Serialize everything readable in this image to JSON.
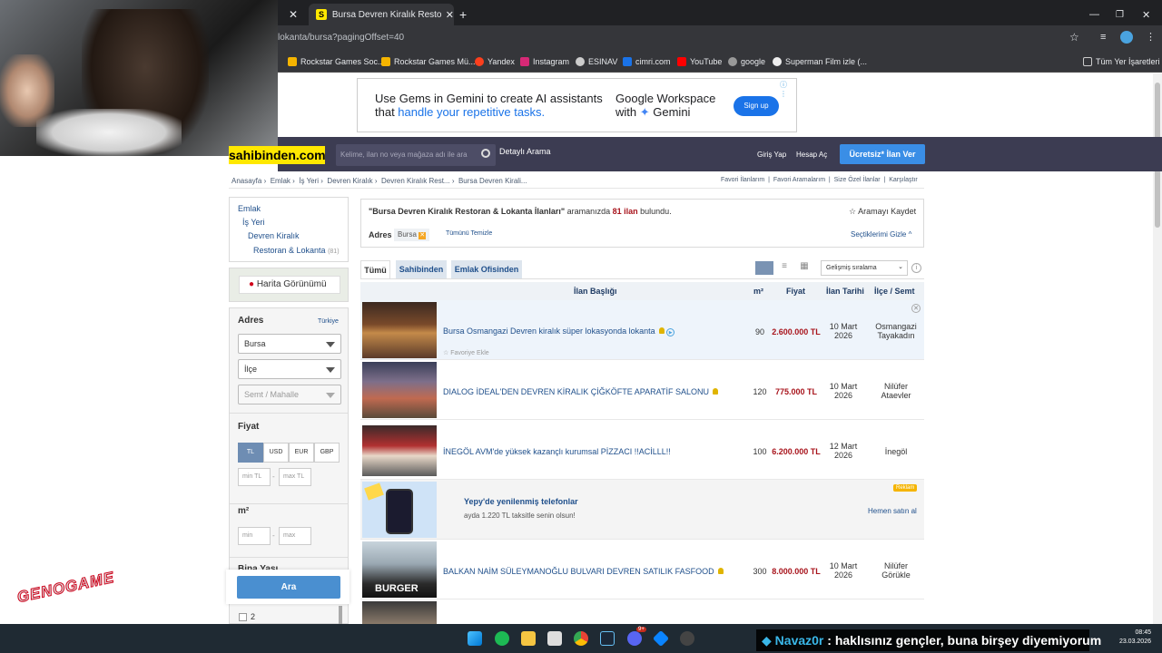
{
  "browser": {
    "active_tab_title": "Bursa Devren Kiralık Restoran &",
    "url": "lokanta/bursa?pagingOffset=40",
    "bookmarks": [
      "Rockstar Games Soc...",
      "Rockstar Games Mü...",
      "Yandex",
      "Instagram",
      "ESINAV",
      "cimri.com",
      "YouTube",
      "google",
      "Superman Film izle (...",
      "Tüm Yer İşaretleri"
    ]
  },
  "ad": {
    "line1": "Use Gems in Gemini to create AI assistants",
    "line2a": "that ",
    "line2b": "handle your repetitive tasks.",
    "brand1": "Google Workspace",
    "brand2a": "with ",
    "brand2b": "Gemini",
    "cta": "Sign up"
  },
  "header": {
    "logo": "sahibinden.com",
    "search_placeholder": "Kelime, ilan no veya mağaza adı ile ara",
    "advanced": "Detaylı Arama",
    "login": "Giriş Yap",
    "register": "Hesap Aç",
    "post_ad": "Ücretsiz* İlan Ver"
  },
  "breadcrumb": [
    "Anasayfa",
    "Emlak",
    "İş Yeri",
    "Devren Kiralık",
    "Devren Kiralık Rest...",
    "Bursa Devren Kirali..."
  ],
  "toplinks": [
    "Favori İlanlarım",
    "Favori Aramalarım",
    "Size Özel İlanlar",
    "Karşılaştır"
  ],
  "categories": {
    "l1": "Emlak",
    "l2": "İş Yeri",
    "l3": "Devren Kiralık",
    "l4": "Restoran & Lokanta",
    "l4_count": "(81)"
  },
  "map_button": "Harita Görünümü",
  "filters": {
    "address_title": "Adres",
    "country": "Türkiye",
    "city": "Bursa",
    "district": "İlçe",
    "neighborhood": "Semt / Mahalle",
    "price_title": "Fiyat",
    "currencies": [
      "TL",
      "USD",
      "EUR",
      "GBP"
    ],
    "min_price": "min TL",
    "max_price": "max TL",
    "m2_title": "m²",
    "min_m2": "min",
    "max_m2": "max",
    "building_age": "Bina Yaşı",
    "age_option": "2",
    "search_button": "Ara"
  },
  "results": {
    "query": "\"Bursa Devren Kiralık Restoran & Lokanta İlanları\"",
    "mid": " aramanızda ",
    "count": "81 ilan",
    "end": " bulundu.",
    "save_search": "Aramayı Kaydet",
    "address_label": "Adres",
    "address_chip": "Bursa",
    "clear_all": "Tümünü Temizle",
    "hide_selected": "Seçtiklerimi Gizle"
  },
  "tabs": [
    "Tümü",
    "Sahibinden",
    "Emlak Ofisinden"
  ],
  "sort": "Gelişmiş sıralama",
  "columns": {
    "title": "İlan Başlığı",
    "m2": "m²",
    "price": "Fiyat",
    "date": "İlan Tarihi",
    "location": "İlçe / Semt"
  },
  "listings": [
    {
      "title": "Bursa Osmangazi Devren kiralık süper lokasyonda lokanta",
      "m2": "90",
      "price": "2.600.000 TL",
      "date1": "10 Mart",
      "date2": "2026",
      "loc1": "Osmangazi",
      "loc2": "Tayakadın",
      "favorite": "Favoriye Ekle"
    },
    {
      "title": "DIALOG İDEAL'DEN DEVREN KİRALIK ÇİĞKÖFTE APARATİF SALONU",
      "m2": "120",
      "price": "775.000 TL",
      "date1": "10 Mart",
      "date2": "2026",
      "loc1": "Nilüfer",
      "loc2": "Ataevler"
    },
    {
      "title": "İNEGÖL AVM'de yüksek kazançlı kurumsal PİZZACI !!ACİLLL!!",
      "m2": "100",
      "price": "6.200.000 TL",
      "date1": "12 Mart",
      "date2": "2026",
      "loc1": "İnegöl",
      "loc2": ""
    },
    {
      "title": "BALKAN NAİM SÜLEYMANOĞLU BULVARI DEVREN SATILIK FASFOOD",
      "m2": "300",
      "price": "8.000.000 TL",
      "date1": "10 Mart",
      "date2": "2026",
      "loc1": "Nilüfer",
      "loc2": "Görükle"
    }
  ],
  "promo": {
    "title": "Yepy'de yenilenmiş telefonlar",
    "subtitle": "ayda 1.220 TL taksitle senin olsun!",
    "badge": "Reklam",
    "cta": "Hemen satın al"
  },
  "taskbar": {
    "time": "08:45",
    "date": "23.03.2026",
    "notification_count": "9+"
  },
  "chat": {
    "user": "Navaz0r",
    "message": " : haklısınız gençler, buna birşey diyemiyorum"
  },
  "colors": {
    "header_bg": "#3c3c52",
    "logo_yellow": "#ffe800",
    "post_ad_blue": "#3a8ee6",
    "price_red": "#a8141c",
    "link_blue": "#1f4f8b"
  }
}
